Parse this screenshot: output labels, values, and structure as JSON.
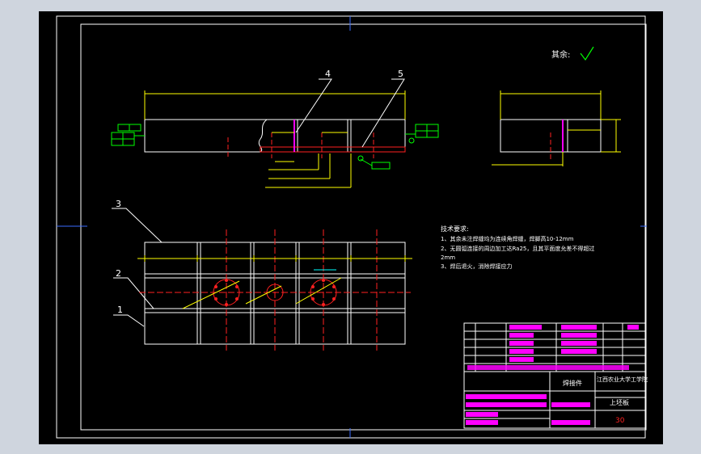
{
  "drawing": {
    "roughness_label": "其余:",
    "notes": {
      "title": "技术要求:",
      "line1": "1、其余未注焊缝均为连续角焊缝，焊脚高10-12mm",
      "line2": "2、无圆弧连接的周边加工达Ra25，且其平面度允差不得超过",
      "line2b": "2mm",
      "line3": "3、焊后退火，消除焊接应力"
    },
    "balloons": [
      "4",
      "5",
      "3",
      "2",
      "1"
    ],
    "titleblock": {
      "name": "焊接件",
      "school": "江西农业大学工学院",
      "part": "上坯板",
      "sheet": "30"
    },
    "colors": {
      "outline": "#ffffff",
      "dimension": "#ffff00",
      "center": "#ff2020",
      "tolerance": "#00ff00",
      "table": "#ff00ff",
      "hole": "#ff2020"
    }
  }
}
